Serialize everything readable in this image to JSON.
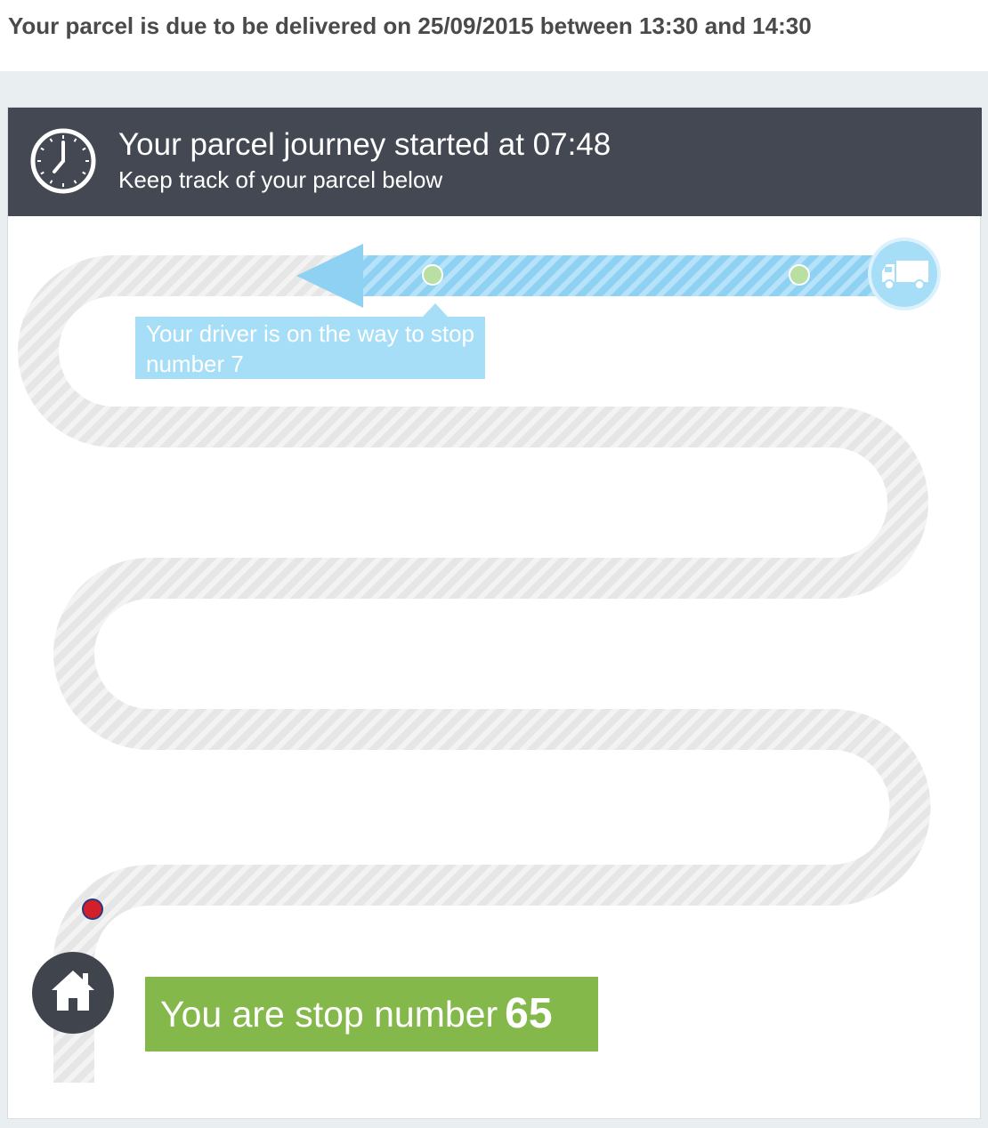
{
  "notice": {
    "text": "Your parcel is due to be delivered on 25/09/2015 between 13:30 and 14:30"
  },
  "header": {
    "title": "Your parcel journey started at 07:48",
    "subtitle": "Keep track of your parcel below",
    "icon": "clock-icon"
  },
  "map": {
    "callout": "Your driver is on the way to stop number 7",
    "truck_icon": "truck-icon",
    "home_icon": "home-icon",
    "colors": {
      "track": "#e6e6e6",
      "track_stripe": "#f4f4f4",
      "progress": "#8fd1f2",
      "progress_stripe": "#b6e3f9",
      "stop_marker": "#b9dfa2",
      "customer_marker": "#d21f2a",
      "banner": "#85b84b",
      "header": "#434852"
    }
  },
  "stop": {
    "label": "You are stop number",
    "number": "65"
  }
}
